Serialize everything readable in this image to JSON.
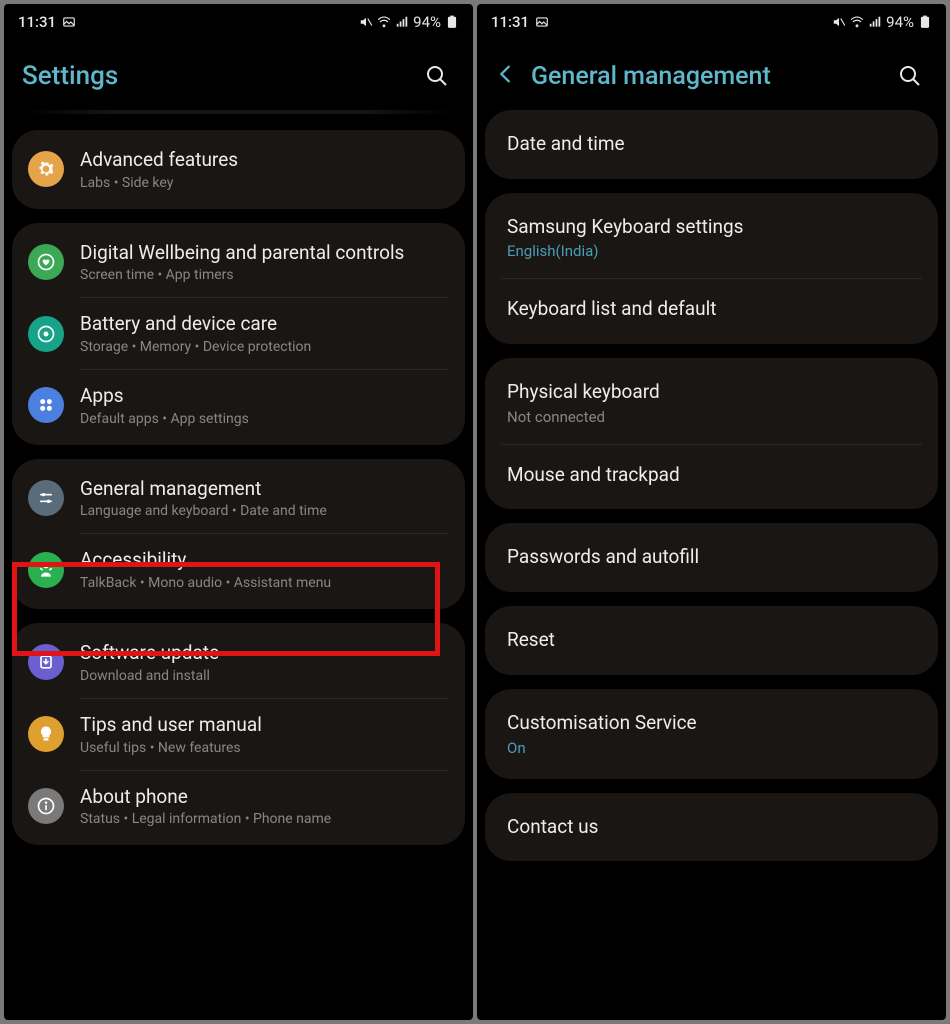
{
  "status": {
    "time": "11:31",
    "battery": "94%"
  },
  "left": {
    "title": "Settings",
    "groups": [
      {
        "items": [
          {
            "icon": "orange",
            "glyph": "gear",
            "title": "Advanced features",
            "sub": "Labs  •  Side key"
          }
        ]
      },
      {
        "items": [
          {
            "icon": "green",
            "glyph": "heart",
            "title": "Digital Wellbeing and parental controls",
            "sub": "Screen time  •  App timers"
          },
          {
            "icon": "teal",
            "glyph": "shield",
            "title": "Battery and device care",
            "sub": "Storage  •  Memory  •  Device protection"
          },
          {
            "icon": "blue",
            "glyph": "apps",
            "title": "Apps",
            "sub": "Default apps  •  App settings"
          }
        ]
      },
      {
        "items": [
          {
            "icon": "slate",
            "glyph": "sliders",
            "title": "General management",
            "sub": "Language and keyboard  •  Date and time",
            "highlighted": true
          },
          {
            "icon": "leaf",
            "glyph": "person",
            "title": "Accessibility",
            "sub": "TalkBack  •  Mono audio  •  Assistant menu"
          }
        ]
      },
      {
        "items": [
          {
            "icon": "violet",
            "glyph": "download",
            "title": "Software update",
            "sub": "Download and install"
          },
          {
            "icon": "amber",
            "glyph": "bulb",
            "title": "Tips and user manual",
            "sub": "Useful tips  •  New features"
          },
          {
            "icon": "gray",
            "glyph": "info",
            "title": "About phone",
            "sub": "Status  •  Legal information  •  Phone name"
          }
        ]
      }
    ]
  },
  "right": {
    "title": "General management",
    "groups": [
      {
        "items": [
          {
            "title": "Date and time"
          }
        ]
      },
      {
        "items": [
          {
            "title": "Samsung Keyboard settings",
            "sub": "English(India)",
            "subBlue": true
          },
          {
            "title": "Keyboard list and default"
          }
        ]
      },
      {
        "items": [
          {
            "title": "Physical keyboard",
            "sub": "Not connected"
          },
          {
            "title": "Mouse and trackpad"
          }
        ]
      },
      {
        "items": [
          {
            "title": "Passwords and autofill"
          }
        ]
      },
      {
        "items": [
          {
            "title": "Reset",
            "highlighted": true
          }
        ]
      },
      {
        "items": [
          {
            "title": "Customisation Service",
            "sub": "On",
            "subBlue": true
          }
        ]
      },
      {
        "items": [
          {
            "title": "Contact us"
          }
        ]
      }
    ]
  }
}
